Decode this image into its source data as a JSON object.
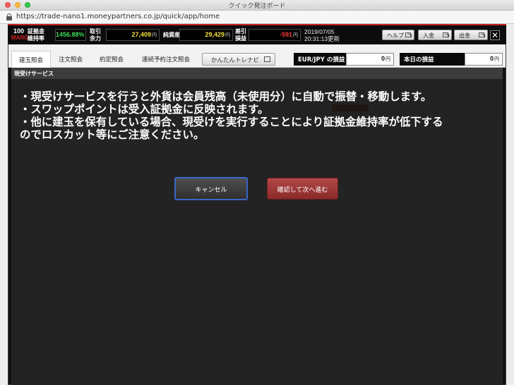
{
  "window": {
    "title": "クイック発注ボード"
  },
  "browser": {
    "url": "https://trade-nano1.moneypartners.co.jp/quick/app/home"
  },
  "header": {
    "logo_line1": "100",
    "logo_line2": "MARG",
    "margin_rate": {
      "label_line1": "証拠金",
      "label_line2": "維持率",
      "value": "1456.88%"
    },
    "available": {
      "label_line1": "取引",
      "label_line2": "余力",
      "value": "27,409",
      "unit": "円"
    },
    "net_assets": {
      "label": "純資産",
      "value": "29,429",
      "unit": "円"
    },
    "pl_diff": {
      "label_line1": "差引",
      "label_line2": "損益",
      "value": "-591",
      "unit": "円"
    },
    "date": "2019/07/05",
    "time": "20:31:13更新",
    "help_label": "ヘルプ",
    "deposit_label": "入金",
    "withdraw_label": "出金",
    "close_label": "✕"
  },
  "tabs": [
    {
      "label": "建玉照会"
    },
    {
      "label": "注文照会"
    },
    {
      "label": "約定照会"
    },
    {
      "label": "連続予約注文照会"
    }
  ],
  "navi_label": "かんたんトレナビ",
  "pair_pl": {
    "label": "EUR/JPY の損益",
    "value": "0",
    "unit": "円"
  },
  "today_pl": {
    "label": "本日の損益",
    "value": "0",
    "unit": "円"
  },
  "panel": {
    "title": "現受けサービス"
  },
  "dialog": {
    "lines": [
      "・現受けサービスを行うと外貨は会員残高（未使用分）に自動で振替・移動します。",
      "・スワップポイントは受入証拠金に反映されます。",
      "・他に建玉を保有している場合、現受けを実行することにより証拠金維持率が低下する",
      "のでロスカット等にご注意ください。"
    ],
    "cancel_label": "キャンセル",
    "confirm_label": "確認して次へ進む"
  },
  "colors": {
    "accent_red": "#c0201e",
    "value_green": "#3fdc5a",
    "value_yellow": "#f3e13a",
    "negative": "#ff3a36",
    "focus_blue": "#3a66c8"
  }
}
